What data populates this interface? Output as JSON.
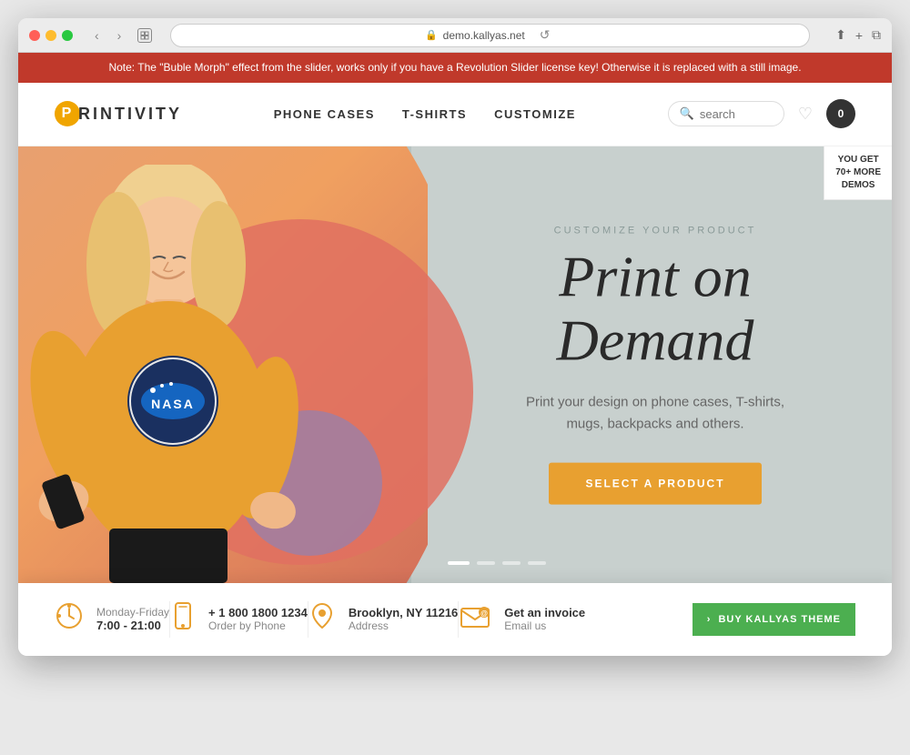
{
  "browser": {
    "url": "demo.kallyas.net",
    "reload_label": "↺"
  },
  "notification": {
    "text": "Note: The \"Buble Morph\" effect from the slider, works only if you have a Revolution Slider license key! Otherwise it is replaced with a still image."
  },
  "header": {
    "logo_letter": "P",
    "logo_text": "RINTIVITY",
    "nav": {
      "items": [
        {
          "label": "PHONE CASES"
        },
        {
          "label": "T-SHIRTS"
        },
        {
          "label": "CUSTOMIZE"
        }
      ]
    },
    "search_placeholder": "search",
    "cart_count": "0"
  },
  "hero": {
    "subtitle": "CUSTOMIZE YOUR PRODUCT",
    "title": "Print on Demand",
    "description": "Print your design on phone cases, T-shirts,\nmugs, backpacks and others.",
    "cta_button": "SELECT A PRODUCT",
    "nasa_text": "NASA",
    "demos_badge_line1": "YOU GET",
    "demos_badge_line2": "70+ MORE",
    "demos_badge_line3": "DEMOS"
  },
  "info_bar": {
    "items": [
      {
        "icon": "clock",
        "line1": "Monday-Friday",
        "line2": "7:00 - 21:00"
      },
      {
        "icon": "phone",
        "line1": "+ 1 800 1800 1234",
        "line2": "Order by Phone"
      },
      {
        "icon": "map",
        "line1": "Brooklyn, NY 11216",
        "line2": "Address"
      },
      {
        "icon": "email",
        "line1": "Get an invoice",
        "line2": "Email us"
      }
    ]
  },
  "buy_theme": {
    "arrow": "›",
    "label": "BUY KALLYAS THEME"
  },
  "colors": {
    "accent_orange": "#e8a030",
    "accent_red": "#c0392b",
    "hero_bg": "#c8d0ce",
    "hero_circle": "#e07060",
    "hero_purple": "#9b7fa8",
    "green": "#4caf50"
  }
}
